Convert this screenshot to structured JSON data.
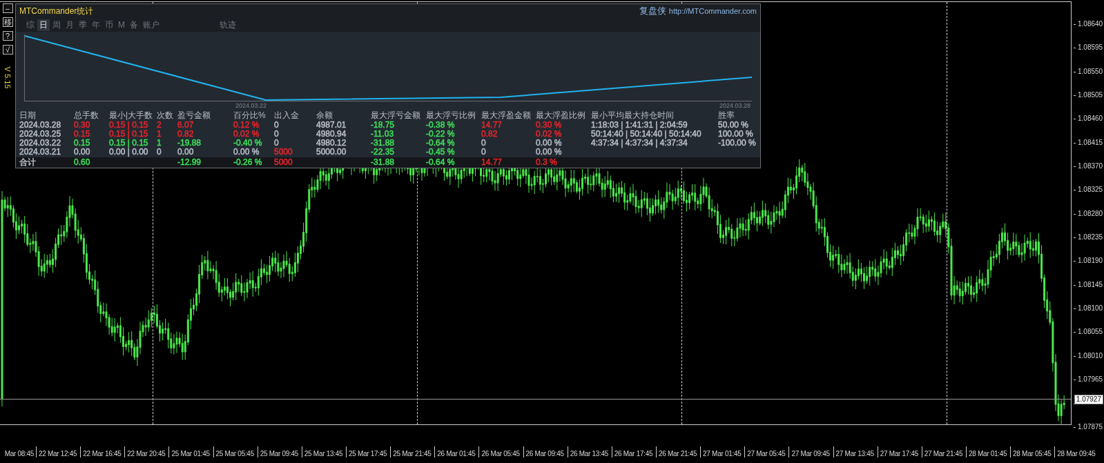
{
  "toolbar": {
    "buttons": [
      {
        "label": "–"
      },
      {
        "label": "移"
      },
      {
        "label": "?"
      },
      {
        "label": "√"
      }
    ],
    "version": "V 5.15"
  },
  "panel": {
    "title": "MTCommander统计",
    "brand": "复盘侠",
    "url": "http://MTCommander.com",
    "tabs": [
      {
        "label": "综",
        "selected": false
      },
      {
        "label": "日",
        "selected": true
      },
      {
        "label": "周",
        "selected": false
      },
      {
        "label": "月",
        "selected": false
      },
      {
        "label": "季",
        "selected": false
      },
      {
        "label": "年",
        "selected": false
      },
      {
        "label": "币",
        "selected": false
      },
      {
        "label": "M",
        "selected": false
      },
      {
        "label": "备",
        "selected": false
      },
      {
        "label": "账户",
        "selected": false
      }
    ],
    "track_tab": {
      "label": "轨迹",
      "selected": false
    },
    "equity_chart": {
      "x_labels": [
        "2024.03.22",
        "2024.03.28"
      ]
    },
    "table": {
      "columns": [
        "日期",
        "总手数",
        "最小|大手数",
        "次数",
        "盈亏金额",
        "百分比%",
        "出入金",
        "余额",
        "最大浮亏金额",
        "最大浮亏比例",
        "最大浮盈金额",
        "最大浮盈比例",
        "最小平均最大持仓时间",
        "胜率"
      ],
      "rows": [
        {
          "kind": "day",
          "cells": [
            {
              "text": "2024.03.28",
              "color": "#b9bfc8"
            },
            {
              "text": "0.30",
              "color": "#e8252b"
            },
            {
              "text": "0.15 | 0.15",
              "color": "#e8252b"
            },
            {
              "text": "2",
              "color": "#e8252b"
            },
            {
              "text": "6.07",
              "color": "#e8252b"
            },
            {
              "text": "0.12 %",
              "color": "#e8252b"
            },
            {
              "text": "0",
              "color": "#b9bfc8"
            },
            {
              "text": "4987.01",
              "color": "#b9bfc8"
            },
            {
              "text": "-18.75",
              "color": "#3ee05a"
            },
            {
              "text": "-0.38 %",
              "color": "#3ee05a"
            },
            {
              "text": "14.77",
              "color": "#e8252b"
            },
            {
              "text": "0.30 %",
              "color": "#e8252b"
            },
            {
              "text": "1:18:03 | 1:41:31 | 2:04:59",
              "color": "#b9bfc8"
            },
            {
              "text": "50.00 %",
              "color": "#b9bfc8"
            }
          ]
        },
        {
          "kind": "day",
          "cells": [
            {
              "text": "2024.03.25",
              "color": "#b9bfc8"
            },
            {
              "text": "0.15",
              "color": "#e8252b"
            },
            {
              "text": "0.15 | 0.15",
              "color": "#e8252b"
            },
            {
              "text": "1",
              "color": "#e8252b"
            },
            {
              "text": "0.82",
              "color": "#e8252b"
            },
            {
              "text": "0.02 %",
              "color": "#e8252b"
            },
            {
              "text": "0",
              "color": "#b9bfc8"
            },
            {
              "text": "4980.94",
              "color": "#b9bfc8"
            },
            {
              "text": "-11.03",
              "color": "#3ee05a"
            },
            {
              "text": "-0.22 %",
              "color": "#3ee05a"
            },
            {
              "text": "0.82",
              "color": "#e8252b"
            },
            {
              "text": "0.02 %",
              "color": "#e8252b"
            },
            {
              "text": "50:14:40 | 50:14:40 | 50:14:40",
              "color": "#b9bfc8"
            },
            {
              "text": "100.00 %",
              "color": "#b9bfc8"
            }
          ]
        },
        {
          "kind": "day",
          "cells": [
            {
              "text": "2024.03.22",
              "color": "#b9bfc8"
            },
            {
              "text": "0.15",
              "color": "#3ee05a"
            },
            {
              "text": "0.15 | 0.15",
              "color": "#3ee05a"
            },
            {
              "text": "1",
              "color": "#3ee05a"
            },
            {
              "text": "-19.88",
              "color": "#3ee05a"
            },
            {
              "text": "-0.40 %",
              "color": "#3ee05a"
            },
            {
              "text": "0",
              "color": "#b9bfc8"
            },
            {
              "text": "4980.12",
              "color": "#b9bfc8"
            },
            {
              "text": "-31.88",
              "color": "#3ee05a"
            },
            {
              "text": "-0.64 %",
              "color": "#3ee05a"
            },
            {
              "text": "0",
              "color": "#b9bfc8"
            },
            {
              "text": "0.00 %",
              "color": "#b9bfc8"
            },
            {
              "text": "4:37:34 | 4:37:34 | 4:37:34",
              "color": "#b9bfc8"
            },
            {
              "text": "-100.00 %",
              "color": "#b9bfc8"
            }
          ]
        },
        {
          "kind": "day",
          "cells": [
            {
              "text": "2024.03.21",
              "color": "#b9bfc8"
            },
            {
              "text": "0.00",
              "color": "#b9bfc8"
            },
            {
              "text": "0.00 | 0.00",
              "color": "#b9bfc8"
            },
            {
              "text": "0",
              "color": "#b9bfc8"
            },
            {
              "text": "0.00",
              "color": "#b9bfc8"
            },
            {
              "text": "0.00 %",
              "color": "#b9bfc8"
            },
            {
              "text": "5000",
              "color": "#e8252b"
            },
            {
              "text": "5000.00",
              "color": "#b9bfc8"
            },
            {
              "text": "-22.35",
              "color": "#3ee05a"
            },
            {
              "text": "-0.45 %",
              "color": "#3ee05a"
            },
            {
              "text": "0",
              "color": "#b9bfc8"
            },
            {
              "text": "0.00 %",
              "color": "#b9bfc8"
            },
            null,
            null
          ]
        },
        {
          "kind": "total",
          "cells": [
            {
              "text": "合计",
              "color": "#b9bfc8"
            },
            {
              "text": "0.60",
              "color": "#3ee05a"
            },
            null,
            null,
            {
              "text": "-12.99",
              "color": "#3ee05a"
            },
            {
              "text": "-0.26 %",
              "color": "#3ee05a"
            },
            {
              "text": "5000",
              "color": "#e8252b"
            },
            null,
            {
              "text": "-31.88",
              "color": "#3ee05a"
            },
            {
              "text": "-0.64 %",
              "color": "#3ee05a"
            },
            {
              "text": "14.77",
              "color": "#e8252b"
            },
            {
              "text": "0.3 %",
              "color": "#e8252b"
            },
            null,
            null
          ]
        }
      ]
    }
  },
  "price_axis": {
    "labels": [
      "1.08640",
      "1.08595",
      "1.08550",
      "1.08505",
      "1.08460",
      "1.08415",
      "1.08370",
      "1.08325",
      "1.08280",
      "1.08235",
      "1.08190",
      "1.08145",
      "1.08100",
      "1.08055",
      "1.08010",
      "1.07965"
    ],
    "bottom_label": "1.07875",
    "current_price": "1.07927"
  },
  "time_axis": {
    "labels": [
      "Mar 08:45",
      "22 Mar 12:45",
      "22 Mar 16:45",
      "22 Mar 20:45",
      "25 Mar 01:45",
      "25 Mar 05:45",
      "25 Mar 09:45",
      "25 Mar 13:45",
      "25 Mar 17:45",
      "25 Mar 21:45",
      "26 Mar 01:45",
      "26 Mar 05:45",
      "26 Mar 09:45",
      "26 Mar 13:45",
      "26 Mar 17:45",
      "26 Mar 21:45",
      "27 Mar 01:45",
      "27 Mar 05:45",
      "27 Mar 09:45",
      "27 Mar 13:45",
      "27 Mar 17:45",
      "27 Mar 21:45",
      "28 Mar 01:45",
      "28 Mar 05:45",
      "28 Mar 09:45"
    ]
  }
}
